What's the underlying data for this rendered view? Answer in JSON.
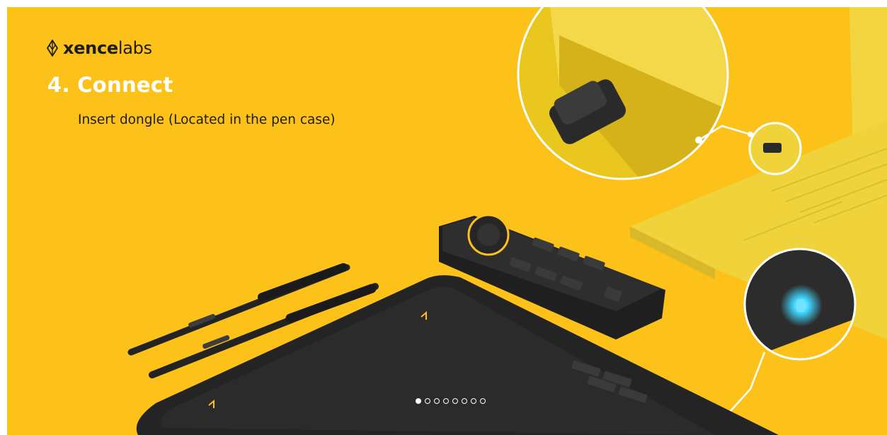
{
  "brand": {
    "name_bold": "xence",
    "name_light": "labs"
  },
  "step": {
    "title": "4. Connect",
    "instruction": "Insert dongle (Located in the pen case)"
  },
  "colors": {
    "background": "#fcc21a",
    "device": "#2a2a2a",
    "laptop": "#f0d23a",
    "led": "#3fd6ff"
  },
  "icons": {
    "logo": "xencelabs-pen-nib-icon"
  },
  "pagination": {
    "total": 8,
    "active_index": 0
  }
}
